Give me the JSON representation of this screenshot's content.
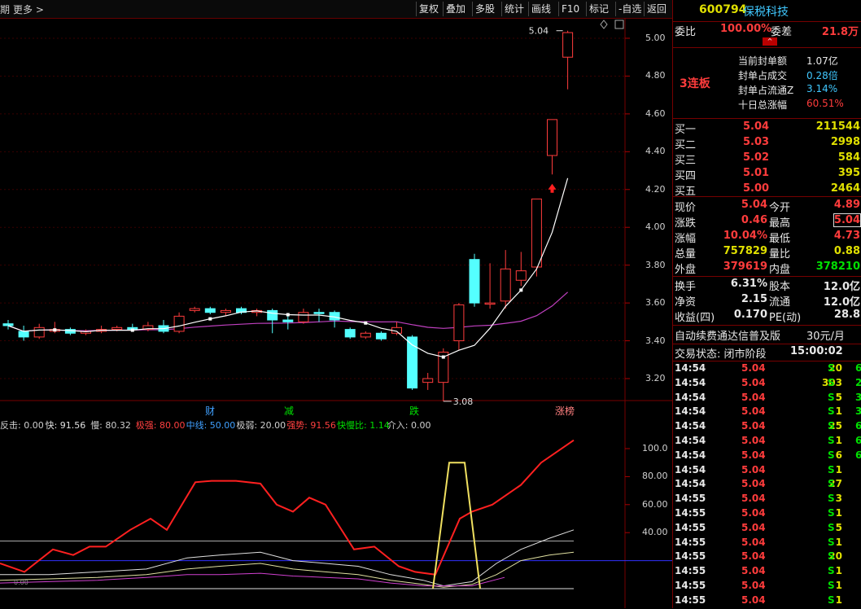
{
  "toolbar": {
    "left_partial": "期",
    "more": "更多 >",
    "buttons": [
      "复权",
      "叠加",
      "多股",
      "统计",
      "画线",
      "F10",
      "标记",
      "-自选",
      "返回"
    ]
  },
  "chart_data": {
    "type": "candlestick",
    "y_axis_price": [
      "5.00",
      "4.80",
      "4.60",
      "4.40",
      "4.20",
      "4.00",
      "3.80",
      "3.60",
      "3.40",
      "3.20"
    ],
    "annotations": {
      "high_label": "5.04",
      "low_label": "3.08"
    },
    "event_markers": [
      "财",
      "减",
      "跌",
      "涨榜"
    ],
    "candles": [
      {
        "o": 3.49,
        "c": 3.48,
        "h": 3.51,
        "l": 3.46
      },
      {
        "o": 3.45,
        "c": 3.42,
        "h": 3.48,
        "l": 3.4
      },
      {
        "o": 3.42,
        "c": 3.47,
        "h": 3.49,
        "l": 3.41
      },
      {
        "o": 3.45,
        "c": 3.46,
        "h": 3.5,
        "l": 3.44
      },
      {
        "o": 3.46,
        "c": 3.44,
        "h": 3.47,
        "l": 3.43
      },
      {
        "o": 3.44,
        "c": 3.45,
        "h": 3.46,
        "l": 3.43
      },
      {
        "o": 3.45,
        "c": 3.46,
        "h": 3.48,
        "l": 3.44
      },
      {
        "o": 3.46,
        "c": 3.47,
        "h": 3.48,
        "l": 3.45
      },
      {
        "o": 3.47,
        "c": 3.46,
        "h": 3.49,
        "l": 3.45
      },
      {
        "o": 3.46,
        "c": 3.48,
        "h": 3.5,
        "l": 3.45
      },
      {
        "o": 3.48,
        "c": 3.45,
        "h": 3.51,
        "l": 3.44
      },
      {
        "o": 3.45,
        "c": 3.53,
        "h": 3.55,
        "l": 3.44
      },
      {
        "o": 3.56,
        "c": 3.57,
        "h": 3.58,
        "l": 3.55
      },
      {
        "o": 3.57,
        "c": 3.55,
        "h": 3.58,
        "l": 3.54
      },
      {
        "o": 3.55,
        "c": 3.56,
        "h": 3.57,
        "l": 3.53
      },
      {
        "o": 3.57,
        "c": 3.55,
        "h": 3.58,
        "l": 3.54
      },
      {
        "o": 3.55,
        "c": 3.56,
        "h": 3.57,
        "l": 3.53
      },
      {
        "o": 3.56,
        "c": 3.51,
        "h": 3.57,
        "l": 3.44
      },
      {
        "o": 3.5,
        "c": 3.51,
        "h": 3.53,
        "l": 3.46
      },
      {
        "o": 3.5,
        "c": 3.55,
        "h": 3.57,
        "l": 3.49
      },
      {
        "o": 3.55,
        "c": 3.55,
        "h": 3.57,
        "l": 3.5
      },
      {
        "o": 3.55,
        "c": 3.51,
        "h": 3.56,
        "l": 3.47
      },
      {
        "o": 3.46,
        "c": 3.42,
        "h": 3.47,
        "l": 3.41
      },
      {
        "o": 3.42,
        "c": 3.44,
        "h": 3.45,
        "l": 3.41
      },
      {
        "o": 3.44,
        "c": 3.41,
        "h": 3.45,
        "l": 3.4
      },
      {
        "o": 3.44,
        "c": 3.47,
        "h": 3.5,
        "l": 3.43
      },
      {
        "o": 3.42,
        "c": 3.15,
        "h": 3.43,
        "l": 3.14
      },
      {
        "o": 3.18,
        "c": 3.2,
        "h": 3.23,
        "l": 3.14
      },
      {
        "o": 3.18,
        "c": 3.34,
        "h": 3.36,
        "l": 3.08
      },
      {
        "o": 3.4,
        "c": 3.59,
        "h": 3.6,
        "l": 3.35
      },
      {
        "o": 3.83,
        "c": 3.6,
        "h": 3.86,
        "l": 3.58
      },
      {
        "o": 3.6,
        "c": 3.6,
        "h": 3.81,
        "l": 3.57
      },
      {
        "o": 3.61,
        "c": 3.78,
        "h": 3.88,
        "l": 3.57
      },
      {
        "o": 3.72,
        "c": 3.77,
        "h": 3.87,
        "l": 3.69
      },
      {
        "o": 3.79,
        "c": 4.15,
        "h": 4.15,
        "l": 3.74
      },
      {
        "o": 4.38,
        "c": 4.57,
        "h": 4.57,
        "l": 4.28
      },
      {
        "o": 4.9,
        "c": 5.03,
        "h": 5.04,
        "l": 4.73
      }
    ],
    "up_candles": [
      2,
      3,
      5,
      6,
      7,
      9,
      11,
      12,
      14,
      16,
      19,
      23,
      25,
      27,
      28,
      29,
      31,
      32,
      33,
      34,
      35,
      36
    ]
  },
  "indicator": {
    "legend": [
      {
        "text": "反击: 0.00",
        "color": "#d0d0d0"
      },
      {
        "text": "快: 91.56",
        "color": "#e0e0e0"
      },
      {
        "text": "慢: 80.32",
        "color": "#d0d0d0"
      },
      {
        "text": "极强: 80.00",
        "color": "#ff4040"
      },
      {
        "text": "中线: 50.00",
        "color": "#40a0ff"
      },
      {
        "text": "极弱: 20.00",
        "color": "#d0d0d0"
      },
      {
        "text": "强势: 91.56",
        "color": "#ff4040"
      },
      {
        "text": "快慢比: 1.14",
        "color": "#00e000"
      },
      {
        "text": "介入: 0.00",
        "color": "#d0d0d0"
      }
    ],
    "y_axis": [
      "100.0",
      "80.00",
      "60.00",
      "40.00"
    ],
    "bottom_tag": "0.00"
  },
  "panel": {
    "code": "600794",
    "name": "保税科技",
    "weibi_label": "委比",
    "weibi_value": "100.00%",
    "weicha_label": "委差",
    "weicha_value": "21.8万",
    "streak": "3连板",
    "info": [
      {
        "label": "当前封单额",
        "value": "1.07亿",
        "vcolor": "#e8e8e8"
      },
      {
        "label": "封单占成交",
        "value": "0.28倍",
        "vcolor": "#40c8ff"
      },
      {
        "label": "封单占流通Z",
        "value": "3.14%",
        "vcolor": "#40c8ff"
      },
      {
        "label": "十日总涨幅",
        "value": "60.51%",
        "vcolor": "#ff3c3c"
      }
    ],
    "bids": [
      {
        "label": "买一",
        "price": "5.04",
        "vol": "211544"
      },
      {
        "label": "买二",
        "price": "5.03",
        "vol": "2998"
      },
      {
        "label": "买三",
        "price": "5.02",
        "vol": "584"
      },
      {
        "label": "买四",
        "price": "5.01",
        "vol": "395"
      },
      {
        "label": "买五",
        "price": "5.00",
        "vol": "2464"
      }
    ],
    "quote": [
      {
        "l1": "现价",
        "v1": "5.04",
        "c1": "red",
        "l2": "今开",
        "v2": "4.89",
        "c2": "red"
      },
      {
        "l1": "涨跌",
        "v1": "0.46",
        "c1": "red",
        "l2": "最高",
        "v2": "5.04",
        "c2": "red"
      },
      {
        "l1": "涨幅",
        "v1": "10.04%",
        "c1": "red",
        "l2": "最低",
        "v2": "4.73",
        "c2": "red"
      },
      {
        "l1": "总量",
        "v1": "757829",
        "c1": "yel",
        "l2": "量比",
        "v2": "0.88",
        "c2": "yel"
      },
      {
        "l1": "外盘",
        "v1": "379619",
        "c1": "red",
        "l2": "内盘",
        "v2": "378210",
        "c2": "grn"
      }
    ],
    "finance": [
      {
        "l1": "换手",
        "v1": "6.31%",
        "l2": "股本",
        "v2": "12.0亿"
      },
      {
        "l1": "净资",
        "v1": "2.15",
        "l2": "流通",
        "v2": "12.0亿"
      },
      {
        "l1": "收益(四)",
        "v1": "0.170",
        "l2": "PE(动)",
        "v2": "28.8"
      }
    ],
    "ad_text": "自动续费通达信普及版",
    "ad_price": "30元/月",
    "status_label": "交易状态: 闭市阶段",
    "status_time": "15:00:02",
    "ticks": [
      {
        "t": "14:54",
        "p": "5.04",
        "v": "20",
        "s": "S"
      },
      {
        "t": "14:54",
        "p": "5.04",
        "v": "303",
        "s": "S"
      },
      {
        "t": "14:54",
        "p": "5.04",
        "v": "5",
        "s": "S"
      },
      {
        "t": "14:54",
        "p": "5.04",
        "v": "1",
        "s": "S"
      },
      {
        "t": "14:54",
        "p": "5.04",
        "v": "25",
        "s": "S"
      },
      {
        "t": "14:54",
        "p": "5.04",
        "v": "1",
        "s": "S"
      },
      {
        "t": "14:54",
        "p": "5.04",
        "v": "6",
        "s": "S"
      },
      {
        "t": "14:54",
        "p": "5.04",
        "v": "1",
        "s": "S"
      },
      {
        "t": "14:54",
        "p": "5.04",
        "v": "27",
        "s": "S"
      },
      {
        "t": "14:55",
        "p": "5.04",
        "v": "3",
        "s": "S"
      },
      {
        "t": "14:55",
        "p": "5.04",
        "v": "1",
        "s": "S"
      },
      {
        "t": "14:55",
        "p": "5.04",
        "v": "5",
        "s": "S"
      },
      {
        "t": "14:55",
        "p": "5.04",
        "v": "1",
        "s": "S"
      },
      {
        "t": "14:55",
        "p": "5.04",
        "v": "20",
        "s": "S"
      },
      {
        "t": "14:55",
        "p": "5.04",
        "v": "1",
        "s": "S"
      },
      {
        "t": "14:55",
        "p": "5.04",
        "v": "1",
        "s": "S"
      },
      {
        "t": "14:55",
        "p": "5.04",
        "v": "1",
        "s": "S"
      }
    ],
    "tick_tail": [
      "6",
      "2",
      "3",
      "3",
      "6",
      "6",
      "6"
    ]
  },
  "colors": {
    "up": "#ff3c3c",
    "down": "#54ffff",
    "ma_white": "#ffffff",
    "ma_purple": "#c040c0"
  }
}
